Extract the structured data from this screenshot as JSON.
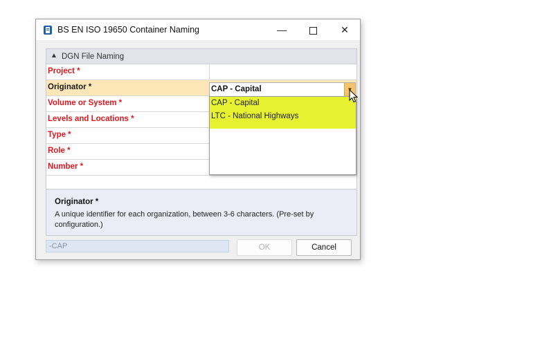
{
  "window": {
    "title": "BS EN ISO 19650 Container Naming",
    "icon": "app-document-icon",
    "controls": {
      "minimize": "—",
      "close": "✕"
    }
  },
  "group": {
    "title": "DGN File Naming",
    "chevron_icon": "chevron-up-icon"
  },
  "fields": [
    {
      "label": "Project *"
    },
    {
      "label": "Originator *",
      "selected": true
    },
    {
      "label": "Volume or System *"
    },
    {
      "label": "Levels and Locations *"
    },
    {
      "label": "Type *"
    },
    {
      "label": "Role *"
    },
    {
      "label": "Number *"
    }
  ],
  "combo": {
    "value": "CAP - Capital",
    "arrow_icon": "dropdown-arrow-icon",
    "options": [
      "CAP - Capital",
      "LTC - National Highways"
    ]
  },
  "description": {
    "title": "Originator *",
    "text": "A unique identifier for each organization, between 3-6 characters. (Pre-set by configuration.)"
  },
  "footer": {
    "code_value": "-CAP",
    "ok_label": "OK",
    "cancel_label": "Cancel"
  },
  "colors": {
    "required_label": "#e0161f",
    "selected_row": "#fde6b8",
    "option_highlight": "#e6f230",
    "dropdown_arrow": "#f5c36b"
  }
}
